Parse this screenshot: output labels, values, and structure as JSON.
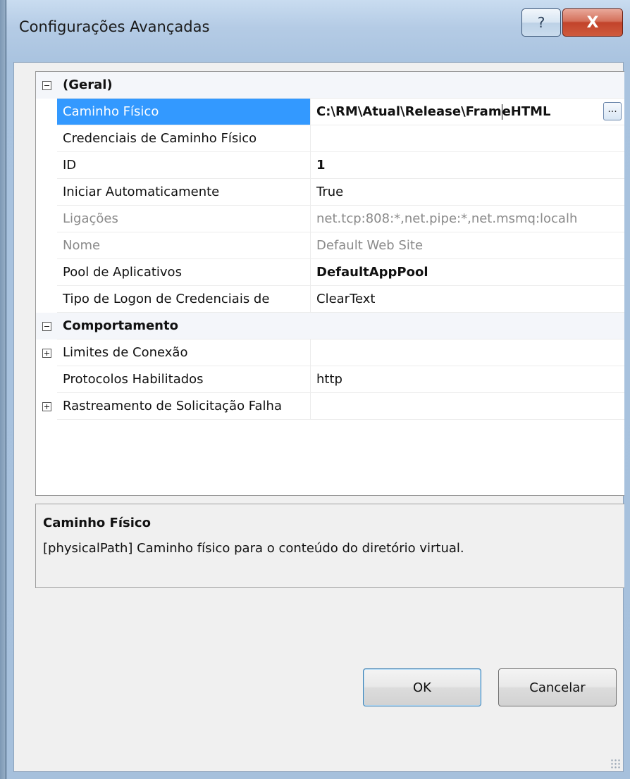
{
  "window": {
    "title": "Configurações Avançadas",
    "help_label": "?",
    "close_label": "X",
    "help_icon": "help-icon",
    "close_icon": "close-icon"
  },
  "grid": {
    "categories": [
      {
        "label": "(Geral)",
        "expanded": true,
        "rows": [
          {
            "name": "Caminho Físico",
            "value_before_caret": "C:\\RM\\Atual\\Release\\Fram",
            "value_after_caret": "eHTML",
            "browse_label": "...",
            "selected": true,
            "bold": true
          },
          {
            "name": "Credenciais de Caminho Físico",
            "value": ""
          },
          {
            "name": "ID",
            "value": "1",
            "bold": true
          },
          {
            "name": "Iniciar Automaticamente",
            "value": "True"
          },
          {
            "name": "Ligações",
            "value": "net.tcp:808:*,net.pipe:*,net.msmq:localh",
            "disabled": true
          },
          {
            "name": "Nome",
            "value": "Default Web Site",
            "disabled": true
          },
          {
            "name": "Pool de Aplicativos",
            "value": "DefaultAppPool",
            "bold": true
          },
          {
            "name": "Tipo de Logon de Credenciais de",
            "value": "ClearText"
          }
        ]
      },
      {
        "label": "Comportamento",
        "expanded": true,
        "rows": [
          {
            "name": "Limites de Conexão",
            "value": "",
            "expandable": true
          },
          {
            "name": "Protocolos Habilitados",
            "value": "http"
          },
          {
            "name": "Rastreamento de Solicitação Falha",
            "value": "",
            "expandable": true
          }
        ]
      }
    ]
  },
  "description": {
    "title": "Caminho Físico",
    "text": "[physicalPath] Caminho físico para o conteúdo do diretório virtual."
  },
  "buttons": {
    "ok_label": "OK",
    "cancel_label": "Cancelar"
  },
  "colors": {
    "selection": "#3399ff",
    "disabled_text": "#8a8a8a"
  }
}
